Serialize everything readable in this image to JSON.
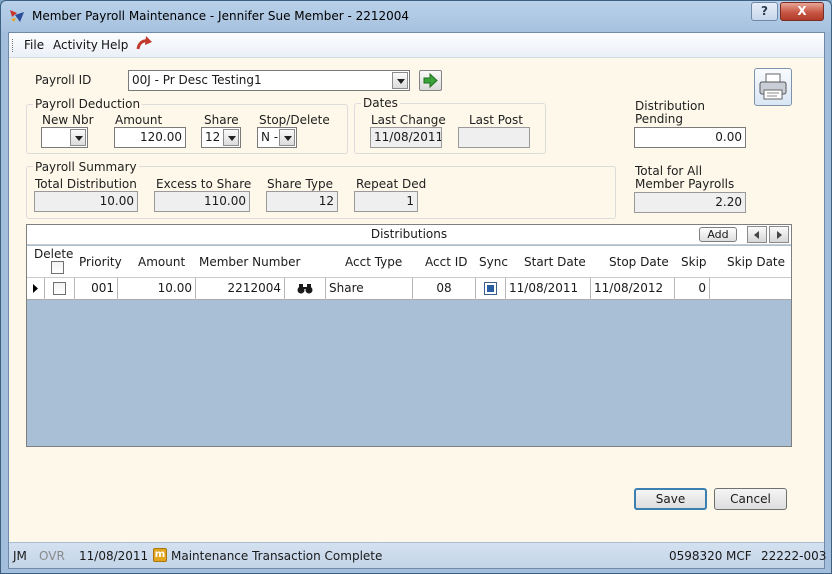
{
  "window": {
    "title": "Member Payroll Maintenance - Jennifer Sue Member - 2212004",
    "help_label": "?",
    "close_label": "X"
  },
  "menu": {
    "file": "File",
    "activity": "Activity",
    "help": "Help"
  },
  "payroll_id": {
    "label": "Payroll ID",
    "value": "00J - Pr Desc Testing1"
  },
  "deduction": {
    "title": "Payroll Deduction",
    "new_nbr_label": "New Nbr",
    "new_nbr_value": "",
    "amount_label": "Amount",
    "amount_value": "120.00",
    "share_label": "Share",
    "share_value": "12",
    "stop_label": "Stop/Delete",
    "stop_value": "N -"
  },
  "dates": {
    "title": "Dates",
    "last_change_label": "Last Change",
    "last_change_value": "11/08/2011",
    "last_post_label": "Last Post",
    "last_post_value": ""
  },
  "pending": {
    "label_line1": "Distribution",
    "label_line2": "Pending",
    "value": "0.00"
  },
  "summary": {
    "title": "Payroll Summary",
    "total_dist_label": "Total Distribution",
    "total_dist_value": "10.00",
    "excess_label": "Excess to Share",
    "excess_value": "110.00",
    "share_type_label": "Share Type",
    "share_type_value": "12",
    "repeat_label": "Repeat Ded",
    "repeat_value": "1"
  },
  "total_all": {
    "label_line1": "Total for All",
    "label_line2": "Member Payrolls",
    "value": "2.20"
  },
  "distributions": {
    "caption": "Distributions",
    "add_label": "Add",
    "columns": {
      "delete": "Delete",
      "priority": "Priority",
      "amount": "Amount",
      "member_number": "Member Number",
      "acct_type": "Acct Type",
      "acct_id": "Acct ID",
      "sync": "Sync",
      "start_date": "Start Date",
      "stop_date": "Stop Date",
      "skip": "Skip",
      "skip_date": "Skip Date"
    },
    "rows": [
      {
        "priority": "001",
        "amount": "10.00",
        "member_number": "2212004",
        "acct_type": "Share",
        "acct_id": "08",
        "start_date": "11/08/2011",
        "stop_date": "11/08/2012",
        "skip": "0",
        "skip_date": ""
      }
    ]
  },
  "buttons": {
    "save": "Save",
    "cancel": "Cancel"
  },
  "status": {
    "user": "JM",
    "ovr": "OVR",
    "date": "11/08/2011",
    "badge": "m",
    "message": "Maintenance Transaction Complete",
    "number": "0598320",
    "code": "MCF",
    "terminal": "22222-003"
  },
  "colors": {
    "status_badge": "#e2a51f",
    "go_arrow": "#3aa33a",
    "grid_background": "#a9bfd6"
  }
}
